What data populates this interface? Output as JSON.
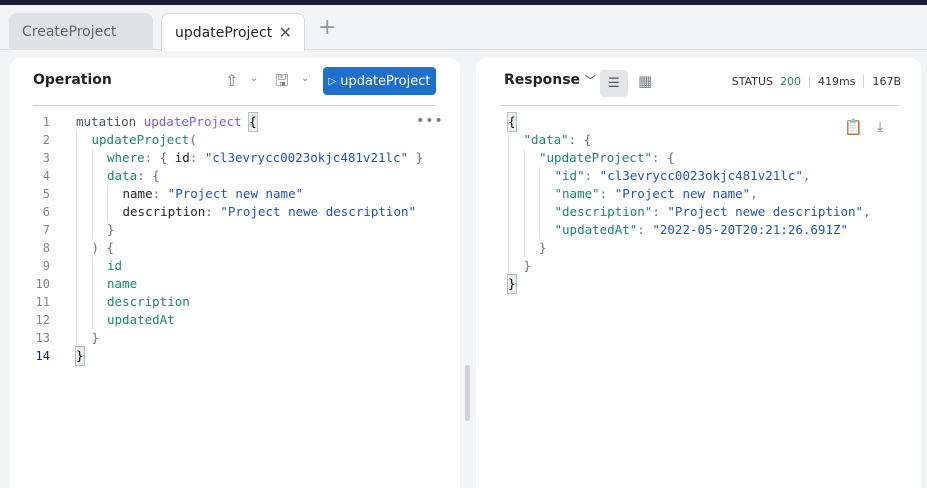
{
  "tabs": [
    {
      "label": "CreateProject",
      "active": false
    },
    {
      "label": "updateProject",
      "active": true
    }
  ],
  "tab_close_icon": "close-icon",
  "add_tab_icon": "plus-icon",
  "operation": {
    "title": "Operation",
    "run_label": "updateProject",
    "run_color": "#1f6fcd",
    "lines": [
      {
        "n": "1",
        "i": 0,
        "t": [
          [
            "kw",
            "mutation "
          ],
          [
            "op",
            "updateProject "
          ],
          [
            "br",
            "{"
          ]
        ]
      },
      {
        "n": "2",
        "i": 1,
        "t": [
          [
            "f",
            "updateProject"
          ],
          [
            "p",
            "("
          ]
        ]
      },
      {
        "n": "3",
        "i": 2,
        "t": [
          [
            "f",
            "where"
          ],
          [
            "p",
            ": { "
          ],
          [
            "a",
            "id"
          ],
          [
            "p",
            ": "
          ],
          [
            "s",
            "\"cl3evrycc0023okjc481v21lc\""
          ],
          [
            "p",
            " }"
          ]
        ]
      },
      {
        "n": "4",
        "i": 2,
        "t": [
          [
            "f",
            "data"
          ],
          [
            "p",
            ": {"
          ]
        ]
      },
      {
        "n": "5",
        "i": 3,
        "t": [
          [
            "a",
            "name"
          ],
          [
            "p",
            ": "
          ],
          [
            "s",
            "\"Project new name\""
          ]
        ]
      },
      {
        "n": "6",
        "i": 3,
        "t": [
          [
            "a",
            "description"
          ],
          [
            "p",
            ": "
          ],
          [
            "s",
            "\"Project newe description\""
          ]
        ]
      },
      {
        "n": "7",
        "i": 2,
        "t": [
          [
            "p",
            "}"
          ]
        ]
      },
      {
        "n": "8",
        "i": 1,
        "t": [
          [
            "p",
            ") {"
          ]
        ]
      },
      {
        "n": "9",
        "i": 2,
        "t": [
          [
            "f",
            "id"
          ]
        ]
      },
      {
        "n": "10",
        "i": 2,
        "t": [
          [
            "f",
            "name"
          ]
        ]
      },
      {
        "n": "11",
        "i": 2,
        "t": [
          [
            "f",
            "description"
          ]
        ]
      },
      {
        "n": "12",
        "i": 2,
        "t": [
          [
            "f",
            "updatedAt"
          ]
        ]
      },
      {
        "n": "13",
        "i": 1,
        "t": [
          [
            "p",
            "}"
          ]
        ]
      },
      {
        "n": "14",
        "i": 0,
        "t": [
          [
            "br",
            "}"
          ]
        ],
        "current": true
      }
    ]
  },
  "response": {
    "title": "Response",
    "status_label": "STATUS",
    "status_code": "200",
    "status_color": "#2e8b57",
    "time": "419ms",
    "size": "167B",
    "lines": [
      {
        "i": 0,
        "t": [
          [
            "br",
            "{"
          ]
        ]
      },
      {
        "i": 1,
        "t": [
          [
            "f",
            "\"data\""
          ],
          [
            "p",
            ": {"
          ]
        ]
      },
      {
        "i": 2,
        "t": [
          [
            "f",
            "\"updateProject\""
          ],
          [
            "p",
            ": {"
          ]
        ]
      },
      {
        "i": 3,
        "t": [
          [
            "f",
            "\"id\""
          ],
          [
            "p",
            ": "
          ],
          [
            "s",
            "\"cl3evrycc0023okjc481v21lc\""
          ],
          [
            "p",
            ","
          ]
        ]
      },
      {
        "i": 3,
        "t": [
          [
            "f",
            "\"name\""
          ],
          [
            "p",
            ": "
          ],
          [
            "s",
            "\"Project new name\""
          ],
          [
            "p",
            ","
          ]
        ]
      },
      {
        "i": 3,
        "t": [
          [
            "f",
            "\"description\""
          ],
          [
            "p",
            ": "
          ],
          [
            "s",
            "\"Project newe description\""
          ],
          [
            "p",
            ","
          ]
        ]
      },
      {
        "i": 3,
        "t": [
          [
            "f",
            "\"updatedAt\""
          ],
          [
            "p",
            ": "
          ],
          [
            "s",
            "\"2022-05-20T20:21:26.691Z\""
          ]
        ]
      },
      {
        "i": 2,
        "t": [
          [
            "p",
            "}"
          ]
        ]
      },
      {
        "i": 1,
        "t": [
          [
            "p",
            "}"
          ]
        ]
      },
      {
        "i": 0,
        "t": [
          [
            "br",
            "}"
          ]
        ]
      }
    ]
  }
}
